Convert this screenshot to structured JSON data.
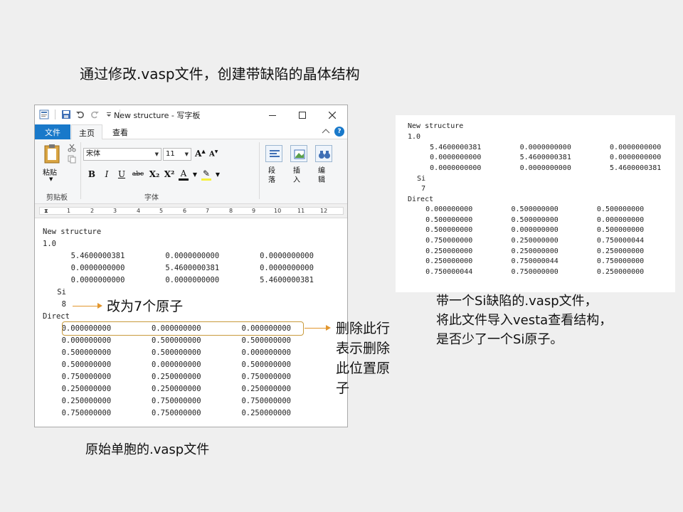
{
  "slide": {
    "title": "通过修改.vasp文件，创建带缺陷的晶体结构"
  },
  "wordpad": {
    "window_title": "New structure - 写字板",
    "tabs": {
      "file": "文件",
      "home": "主页",
      "view": "查看"
    },
    "help": "?",
    "clipboard": {
      "paste": "粘贴",
      "group_label": "剪贴板"
    },
    "font": {
      "name": "宋体",
      "size": "11",
      "group_label": "字体"
    },
    "format_buttons": [
      "B",
      "I",
      "U",
      "abc",
      "X₂",
      "X²",
      "A",
      "✎"
    ],
    "paragraph_label": "段落",
    "insert_label": "插入",
    "edit_label": "编辑",
    "ruler_numbers": [
      "1",
      "2",
      "3",
      "4",
      "5",
      "6",
      "7",
      "8",
      "9",
      "10",
      "11",
      "12"
    ]
  },
  "original_file": {
    "lines": [
      "New structure",
      "1.0",
      "        5.4600000381         0.0000000000         0.0000000000",
      "        0.0000000000         5.4600000381         0.0000000000",
      "        0.0000000000         0.0000000000         5.4600000381",
      "    Si",
      "     8",
      "Direct",
      "     0.000000000         0.000000000         0.000000000",
      "     0.000000000         0.500000000         0.500000000",
      "     0.500000000         0.500000000         0.000000000",
      "     0.500000000         0.000000000         0.500000000",
      "     0.750000000         0.250000000         0.750000000",
      "     0.250000000         0.250000000         0.250000000",
      "     0.250000000         0.750000000         0.750000000",
      "     0.750000000         0.750000000         0.250000000"
    ]
  },
  "annotations": {
    "change_to_7": "改为7个原子",
    "delete_row_lines": [
      "删除此行",
      "表示删除",
      "此位置原",
      "子"
    ]
  },
  "captions": {
    "original": "原始单胞的.vasp文件",
    "defect_lines": [
      "带一个Si缺陷的.vasp文件，",
      "将此文件导入vesta查看结构，",
      "是否少了一个Si原子。"
    ]
  },
  "defect_file": {
    "lines": [
      "New structure",
      "1.0",
      "        5.4600000381         0.0000000000         0.0000000000",
      "        0.0000000000         5.4600000381         0.0000000000",
      "        0.0000000000         0.0000000000         5.4600000381",
      "    Si",
      "     7",
      "Direct",
      "     0.000000000         0.500000000         0.500000000",
      "     0.500000000         0.500000000         0.000000000",
      "     0.500000000         0.000000000         0.500000000",
      "     0.750000000         0.250000000         0.750000044",
      "     0.250000000         0.250000000         0.250000000",
      "     0.250000000         0.750000044         0.750000000",
      "     0.750000044         0.750000000         0.250000000"
    ]
  },
  "colors": {
    "accent_blue": "#1979ca",
    "annotation_orange": "#e2962e",
    "highlight_border": "#c89a3c"
  }
}
